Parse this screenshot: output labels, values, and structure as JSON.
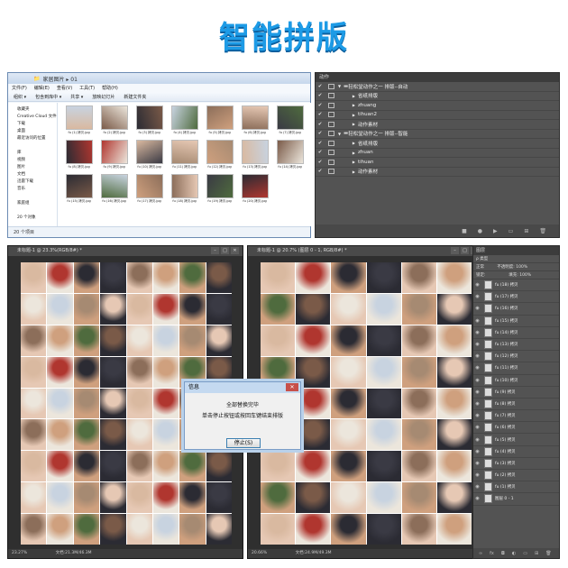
{
  "title": "智能拼版",
  "explorer": {
    "path": "家居图片 ▸ 01",
    "menu": [
      "文件(F)",
      "编辑(E)",
      "查看(V)",
      "工具(T)",
      "帮助(H)"
    ],
    "toolbar": [
      "组织 ▾",
      "包含到库中 ▾",
      "共享 ▾",
      "放映幻灯片",
      "新建文件夹"
    ],
    "nav": [
      "收藏夹",
      "Creative Cloud 文件",
      "下载",
      "桌面",
      "最近访问的位置",
      "",
      "库",
      "视频",
      "图片",
      "文档",
      "迅雷下载",
      "音乐",
      "",
      "家庭组",
      "",
      "20 个对象"
    ],
    "files": [
      "fu (1) 拷贝.jpg",
      "fu (2) 拷贝.jpg",
      "fu (3) 拷贝.jpg",
      "fu (4) 拷贝.jpg",
      "fu (5) 拷贝.jpg",
      "fu (6) 拷贝.jpg",
      "fu (7) 拷贝.jpg",
      "fu (8) 拷贝.jpg",
      "fu (9) 拷贝.jpg",
      "fu (10) 拷贝.jpg",
      "fu (11) 拷贝.jpg",
      "fu (12) 拷贝.jpg",
      "fu (13) 拷贝.jpg",
      "fu (14) 拷贝.jpg",
      "fu (15) 拷贝.jpg",
      "fu (16) 拷贝.jpg",
      "fu (17) 拷贝.jpg",
      "fu (18) 拷贝.jpg",
      "fu (19) 拷贝.jpg",
      "fu (20) 拷贝.jpg"
    ],
    "status": "20 个项目"
  },
  "actions": {
    "tab": "动作",
    "rows": [
      {
        "label": "轻松堂动作之一 排版--自动",
        "indent": 0,
        "folder": true
      },
      {
        "label": "省纸排版",
        "indent": 1,
        "folder": false
      },
      {
        "label": "zhuang",
        "indent": 1,
        "folder": false
      },
      {
        "label": "tihuan2",
        "indent": 1,
        "folder": false
      },
      {
        "label": "动作素材",
        "indent": 1,
        "folder": false
      },
      {
        "label": "轻松堂动作之一 排版--智能",
        "indent": 0,
        "folder": true
      },
      {
        "label": "省纸排版",
        "indent": 1,
        "folder": false
      },
      {
        "label": "zhuan",
        "indent": 1,
        "folder": false
      },
      {
        "label": "tihuan",
        "indent": 1,
        "folder": false
      },
      {
        "label": "动作素材",
        "indent": 1,
        "folder": false
      }
    ]
  },
  "doc1": {
    "title": "未标题-1 @ 23.3%(RGB/8#) *",
    "zoom": "23.27%",
    "info": "文档:21.3M/46.3M"
  },
  "doc2": {
    "title": "未标题-1 @ 20.7% (图层 0 - 1, RGB/8#) *",
    "zoom": "20.66%",
    "info": "文档:24.9M/49.3M"
  },
  "dialog": {
    "title": "信息",
    "line1": "全部替换完毕",
    "line2": "单击停止按钮或按回车键结束排版",
    "button": "停止(S)"
  },
  "layers": {
    "tab": "图层",
    "kind": "ρ 类型",
    "mode": "正常",
    "opacity": "不透明度: 100%",
    "lock": "锁定:",
    "fill": "填充: 100%",
    "rows": [
      "fu (18) 拷贝",
      "fu (17) 拷贝",
      "fu (16) 拷贝",
      "fu (15) 拷贝",
      "fu (14) 拷贝",
      "fu (13) 拷贝",
      "fu (12) 拷贝",
      "fu (11) 拷贝",
      "fu (10) 拷贝",
      "fu (9) 拷贝",
      "fu (8) 拷贝",
      "fu (7) 拷贝",
      "fu (6) 拷贝",
      "fu (5) 拷贝",
      "fu (4) 拷贝",
      "fu (3) 拷贝",
      "fu (2) 拷贝",
      "fu (1) 拷贝",
      "图层 0 - 1"
    ]
  },
  "colors": {
    "title": "#1d9be6",
    "ps_panel": "#535353",
    "photo_palette": [
      "#d9b9a0",
      "#7a5a48",
      "#2b2b33",
      "#c8d3e0",
      "#8c6e5a",
      "#e6c8b4",
      "#4f6b3e",
      "#b0362f",
      "#ece6dc",
      "#3a3a44",
      "#a68a72",
      "#cfa07e"
    ]
  }
}
